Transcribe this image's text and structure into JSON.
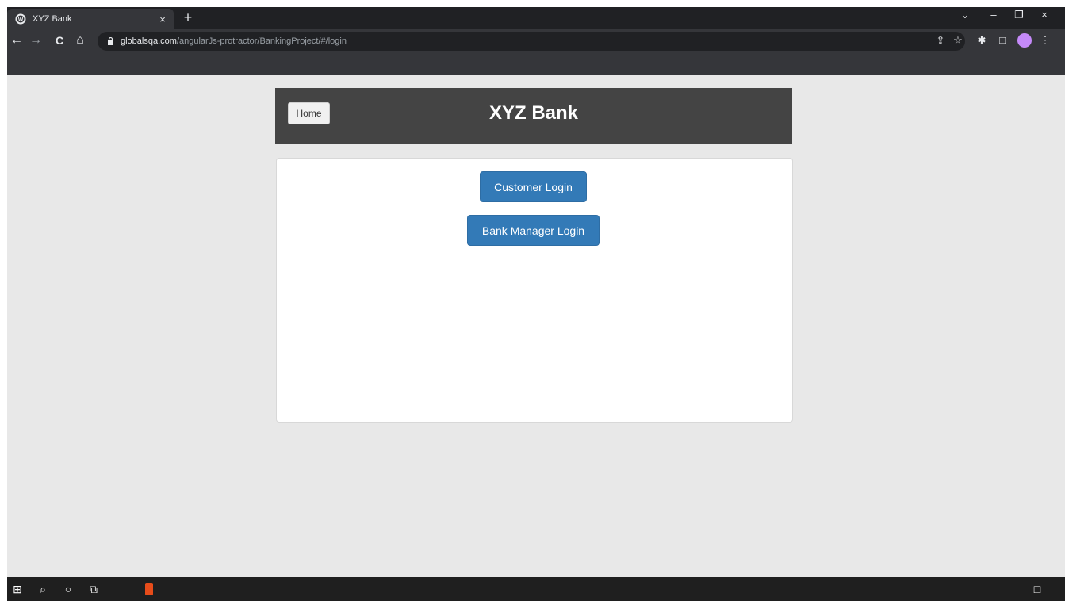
{
  "browser": {
    "tab": {
      "title": "XYZ Bank",
      "close": "×"
    },
    "new_tab": "+",
    "window_controls": {
      "chevron": "⌄",
      "minimize": "–",
      "restore": "❐",
      "close": "×"
    },
    "nav": {
      "back": "←",
      "forward": "→",
      "reload": "C",
      "home": "⌂"
    },
    "url": {
      "domain": "globalsqa.com",
      "path": "/angularJs-protractor/BankingProject/#/login"
    },
    "toolbar_icons": {
      "share": "⇪",
      "star": "☆",
      "extensions": "✱",
      "sidepanel": "□",
      "menu": "⋮"
    }
  },
  "page": {
    "header": {
      "home_label": "Home",
      "title": "XYZ Bank"
    },
    "buttons": {
      "customer_login": "Customer Login",
      "manager_login": "Bank Manager Login"
    }
  },
  "taskbar": {
    "start": "⊞",
    "search": "⌕",
    "cortana": "○",
    "taskview": "⧉",
    "notification": "□"
  },
  "colors": {
    "primary": "#337ab7",
    "header_bg": "#444444",
    "page_bg": "#e8e8e8"
  }
}
